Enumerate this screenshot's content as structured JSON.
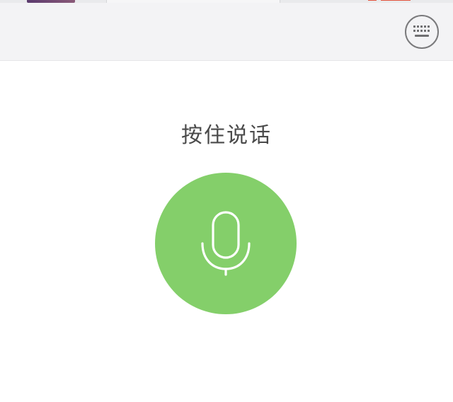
{
  "colors": {
    "mic_button": "#84cf6a",
    "toolbar_bg": "#f3f3f5",
    "hint_text": "#4a4a4a",
    "icon_stroke": "#7a7a7c"
  },
  "toolbar": {
    "keyboard_toggle_icon": "keyboard-icon"
  },
  "voice": {
    "hint": "按住说话",
    "mic_icon": "microphone-icon"
  }
}
